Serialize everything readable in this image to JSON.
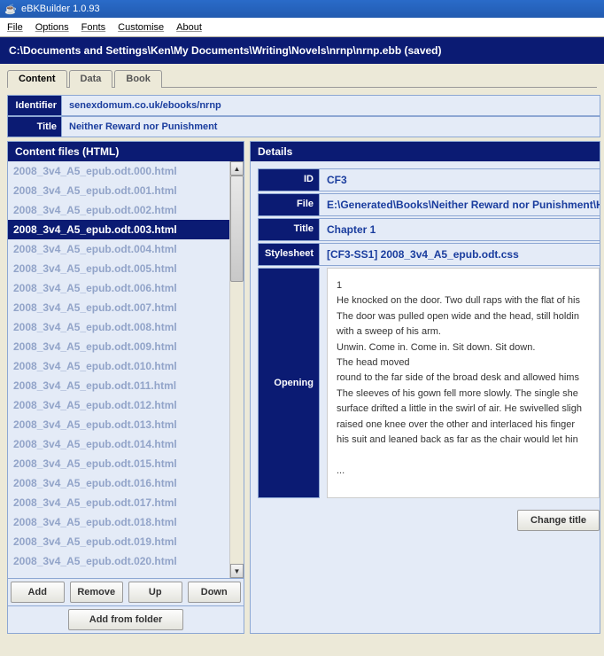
{
  "title": "eBKBuilder 1.0.93",
  "menu": [
    "File",
    "Options",
    "Fonts",
    "Customise",
    "About"
  ],
  "path": "C:\\Documents and Settings\\Ken\\My Documents\\Writing\\Novels\\nrnp\\nrnp.ebb (saved)",
  "tabs": [
    "Content",
    "Data",
    "Book"
  ],
  "form": {
    "identifier_label": "Identifier",
    "identifier_value": "senexdomum.co.uk/ebooks/nrnp",
    "title_label": "Title",
    "title_value": "Neither Reward nor Punishment"
  },
  "left": {
    "heading": "Content files (HTML)",
    "items": [
      "2008_3v4_A5_epub.odt.000.html",
      "2008_3v4_A5_epub.odt.001.html",
      "2008_3v4_A5_epub.odt.002.html",
      "2008_3v4_A5_epub.odt.003.html",
      "2008_3v4_A5_epub.odt.004.html",
      "2008_3v4_A5_epub.odt.005.html",
      "2008_3v4_A5_epub.odt.006.html",
      "2008_3v4_A5_epub.odt.007.html",
      "2008_3v4_A5_epub.odt.008.html",
      "2008_3v4_A5_epub.odt.009.html",
      "2008_3v4_A5_epub.odt.010.html",
      "2008_3v4_A5_epub.odt.011.html",
      "2008_3v4_A5_epub.odt.012.html",
      "2008_3v4_A5_epub.odt.013.html",
      "2008_3v4_A5_epub.odt.014.html",
      "2008_3v4_A5_epub.odt.015.html",
      "2008_3v4_A5_epub.odt.016.html",
      "2008_3v4_A5_epub.odt.017.html",
      "2008_3v4_A5_epub.odt.018.html",
      "2008_3v4_A5_epub.odt.019.html",
      "2008_3v4_A5_epub.odt.020.html"
    ],
    "selected_index": 3,
    "buttons": {
      "add": "Add",
      "remove": "Remove",
      "up": "Up",
      "down": "Down",
      "add_folder": "Add from folder"
    }
  },
  "right": {
    "heading": "Details",
    "labels": {
      "id": "ID",
      "file": "File",
      "title": "Title",
      "stylesheet": "Stylesheet",
      "opening": "Opening"
    },
    "values": {
      "id": "CF3",
      "file": "E:\\Generated\\Books\\Neither Reward nor Punishment\\HTM",
      "title": "Chapter 1",
      "stylesheet": "[CF3-SS1] 2008_3v4_A5_epub.odt.css"
    },
    "opening_lines": [
      " 1",
      "He knocked on the door. Two dull raps with the flat of his",
      "The door was pulled open wide and the head, still holdin",
      "with a sweep of his arm.",
      "Unwin. Come in. Come in. Sit down. Sit down.",
      "The head moved",
      "round to the far side of the broad desk and allowed hims",
      "The sleeves of his gown fell more slowly. The single she",
      "surface drifted a little in the swirl of air. He swivelled sligh",
      "raised one knee over the other and interlaced his  finger",
      "his suit and leaned back as far as the chair would let hin",
      "",
      "..."
    ],
    "change_title": "Change title"
  }
}
